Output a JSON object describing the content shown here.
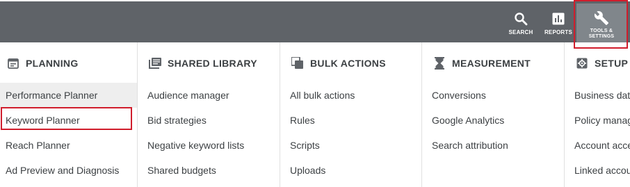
{
  "topbar": {
    "bg_color": "#5f6368",
    "buttons": [
      {
        "label": "SEARCH",
        "icon": "search-icon"
      },
      {
        "label": "REPORTS",
        "icon": "reports-icon"
      },
      {
        "label": "TOOLS &\nSETTINGS",
        "icon": "wrench-icon",
        "selected": true
      }
    ]
  },
  "highlight_color": "#d01d2c",
  "columns": [
    {
      "title": "PLANNING",
      "icon": "calendar-icon",
      "items": [
        "Performance Planner",
        "Keyword Planner",
        "Reach Planner",
        "Ad Preview and Diagnosis"
      ],
      "active_index": 0,
      "highlighted_index": 1
    },
    {
      "title": "SHARED LIBRARY",
      "icon": "library-icon",
      "items": [
        "Audience manager",
        "Bid strategies",
        "Negative keyword lists",
        "Shared budgets"
      ]
    },
    {
      "title": "BULK ACTIONS",
      "icon": "copy-stack-icon",
      "items": [
        "All bulk actions",
        "Rules",
        "Scripts",
        "Uploads"
      ]
    },
    {
      "title": "MEASUREMENT",
      "icon": "hourglass-icon",
      "items": [
        "Conversions",
        "Google Analytics",
        "Search attribution"
      ]
    },
    {
      "title": "SETUP",
      "icon": "gear-icon",
      "items": [
        "Business data",
        "Policy manager",
        "Account access",
        "Linked accounts"
      ]
    }
  ]
}
